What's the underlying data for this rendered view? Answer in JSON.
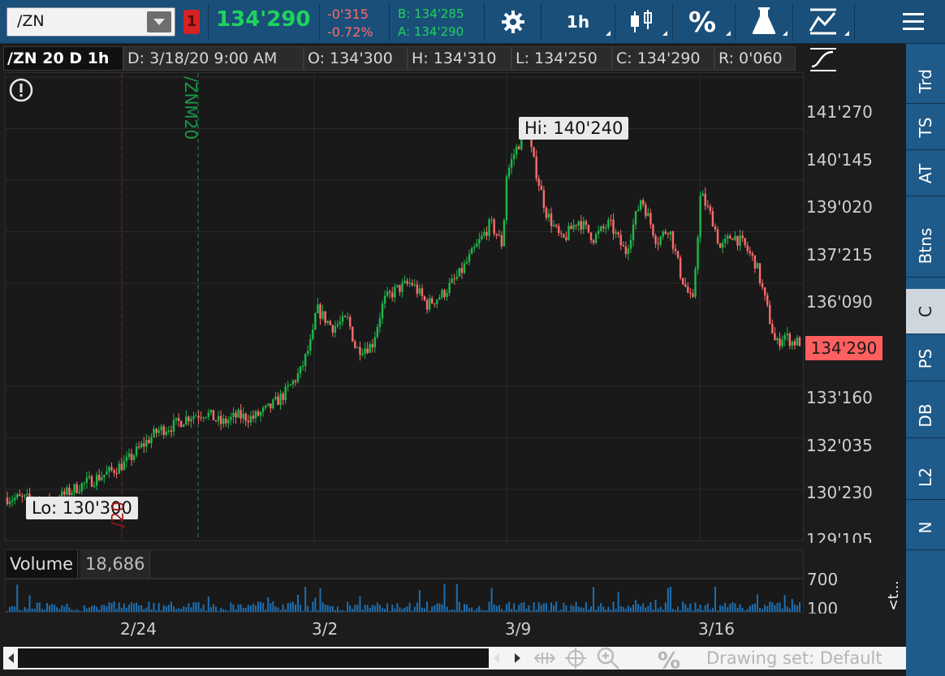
{
  "toolbar": {
    "symbol": "/ZN",
    "link_badge": "1",
    "last_price": "134'290",
    "net_change": "-0'315",
    "percent_change": "-0.72%",
    "bid": "B: 134'285",
    "ask": "A: 134'290",
    "aggregation": "1h",
    "buttons": [
      "settings-icon",
      "aggregation",
      "chart-style-icon",
      "percent-icon",
      "studies-icon",
      "drawings-icon",
      "menu-icon"
    ]
  },
  "header": {
    "title": "/ZN 20 D 1h",
    "date": "D: 3/18/20 9:00 AM",
    "open": "O: 134'300",
    "high": "H: 134'310",
    "low": "L: 134'250",
    "close": "C: 134'290",
    "range": "R: 0'060"
  },
  "price_axis": {
    "ticks": [
      "141'270",
      "140'145",
      "139'020",
      "137'215",
      "136'090",
      "133'160",
      "132'035",
      "130'230",
      "129'105"
    ],
    "last_tag": "134'290"
  },
  "annotations": {
    "hi": "Hi: 140'240",
    "lo": "Lo: 130'300",
    "rollover_new": "/ZNM20",
    "rollover_old": "/20"
  },
  "volume": {
    "label": "Volume",
    "value": "18,686",
    "ticks": [
      "700",
      "100"
    ]
  },
  "time_axis": {
    "ticks": [
      "2/24",
      "3/2",
      "3/9",
      "3/16"
    ]
  },
  "bottom": {
    "drawing_set": "Drawing set: Default"
  },
  "sidebar": {
    "tabs": [
      "Trd",
      "TS",
      "AT",
      "Btns",
      "C",
      "PS",
      "DB",
      "L2",
      "N"
    ],
    "active": "C",
    "collapse": "<t..."
  },
  "colors": {
    "up": "#1fb84a",
    "down": "#ff6b6b",
    "toolbar": "#1a4f7a"
  },
  "chart_data": {
    "type": "candlestick",
    "title": "/ZN 20 D 1h",
    "ylim": [
      129.3,
      141.95
    ],
    "y_ticks": [
      129.33,
      130.72,
      132.11,
      133.5,
      136.28,
      137.67,
      139.06,
      140.45,
      141.84
    ],
    "path": [
      [
        0,
        130.5
      ],
      [
        0.03,
        130.45
      ],
      [
        0.05,
        130.35
      ],
      [
        0.07,
        130.55
      ],
      [
        0.09,
        130.8
      ],
      [
        0.11,
        131.0
      ],
      [
        0.13,
        131.2
      ],
      [
        0.15,
        131.45
      ],
      [
        0.17,
        131.9
      ],
      [
        0.19,
        132.3
      ],
      [
        0.21,
        132.45
      ],
      [
        0.23,
        132.7
      ],
      [
        0.25,
        132.8
      ],
      [
        0.27,
        132.5
      ],
      [
        0.29,
        132.7
      ],
      [
        0.31,
        132.65
      ],
      [
        0.33,
        132.9
      ],
      [
        0.35,
        133.3
      ],
      [
        0.37,
        133.9
      ],
      [
        0.385,
        134.8
      ],
      [
        0.39,
        135.6
      ],
      [
        0.41,
        135.1
      ],
      [
        0.43,
        135.3
      ],
      [
        0.44,
        134.5
      ],
      [
        0.46,
        134.6
      ],
      [
        0.475,
        135.8
      ],
      [
        0.49,
        136.1
      ],
      [
        0.51,
        136.3
      ],
      [
        0.53,
        135.7
      ],
      [
        0.55,
        136.0
      ],
      [
        0.57,
        136.5
      ],
      [
        0.59,
        137.2
      ],
      [
        0.61,
        137.9
      ],
      [
        0.625,
        137.3
      ],
      [
        0.63,
        139.2
      ],
      [
        0.64,
        139.8
      ],
      [
        0.655,
        140.45
      ],
      [
        0.665,
        139.5
      ],
      [
        0.68,
        138.2
      ],
      [
        0.7,
        137.4
      ],
      [
        0.72,
        138.0
      ],
      [
        0.74,
        137.5
      ],
      [
        0.76,
        137.9
      ],
      [
        0.78,
        137.1
      ],
      [
        0.8,
        138.6
      ],
      [
        0.82,
        137.4
      ],
      [
        0.835,
        137.8
      ],
      [
        0.85,
        136.5
      ],
      [
        0.865,
        135.7
      ],
      [
        0.875,
        138.7
      ],
      [
        0.89,
        138.0
      ],
      [
        0.9,
        137.2
      ],
      [
        0.915,
        137.6
      ],
      [
        0.93,
        137.3
      ],
      [
        0.945,
        136.8
      ],
      [
        0.96,
        135.5
      ],
      [
        0.97,
        134.6
      ],
      [
        0.98,
        134.9
      ],
      [
        0.99,
        134.7
      ],
      [
        1.0,
        134.7
      ]
    ]
  }
}
